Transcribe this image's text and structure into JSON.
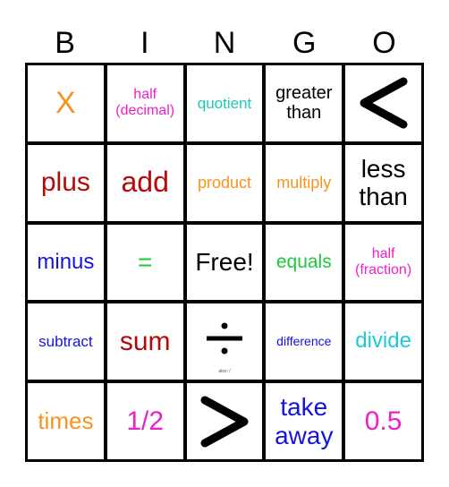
{
  "header": {
    "letters": [
      "B",
      "I",
      "N",
      "G",
      "O"
    ]
  },
  "cells": [
    {
      "text": "X",
      "color": "#f7941d",
      "size": 34
    },
    {
      "text": "half\n(decimal)",
      "color": "#ec1fc8",
      "size": 16
    },
    {
      "text": "quotient",
      "color": "#1ec8b4",
      "size": 17
    },
    {
      "text": "greater\nthan",
      "color": "#000000",
      "size": 20
    },
    {
      "text": "",
      "icon": "less-than-icon",
      "color": "#000000"
    },
    {
      "text": "plus",
      "color": "#b40a0a",
      "size": 30
    },
    {
      "text": "add",
      "color": "#b40a0a",
      "size": 32
    },
    {
      "text": "product",
      "color": "#f7941d",
      "size": 18
    },
    {
      "text": "multiply",
      "color": "#f7941d",
      "size": 18
    },
    {
      "text": "less\nthan",
      "color": "#000000",
      "size": 28
    },
    {
      "text": "minus",
      "color": "#1414dc",
      "size": 24
    },
    {
      "text": "=",
      "color": "#1ec83c",
      "size": 28
    },
    {
      "text": "Free!",
      "color": "#000000",
      "size": 28
    },
    {
      "text": "equals",
      "color": "#1ec83c",
      "size": 21
    },
    {
      "text": "half\n(fraction)",
      "color": "#ec1fc8",
      "size": 16
    },
    {
      "text": "subtract",
      "color": "#1414dc",
      "size": 17
    },
    {
      "text": "sum",
      "color": "#b40a0a",
      "size": 30
    },
    {
      "text": "",
      "icon": "divide-icon",
      "color": "#000000",
      "note": "also: /"
    },
    {
      "text": "difference",
      "color": "#1414dc",
      "size": 14
    },
    {
      "text": "divide",
      "color": "#1ecad8",
      "size": 24
    },
    {
      "text": "times",
      "color": "#f7941d",
      "size": 26
    },
    {
      "text": "1/2",
      "color": "#ec1fc8",
      "size": 30
    },
    {
      "text": "",
      "icon": "greater-than-icon",
      "color": "#000000"
    },
    {
      "text": "take\naway",
      "color": "#1414dc",
      "size": 28
    },
    {
      "text": "0.5",
      "color": "#ec1fc8",
      "size": 30
    }
  ]
}
